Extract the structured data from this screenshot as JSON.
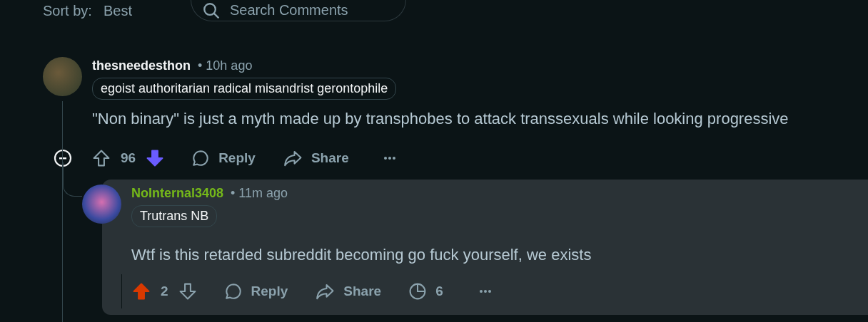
{
  "toolbar": {
    "sort_label": "Sort by:",
    "sort_value": "Best",
    "search": {
      "placeholder": "Search Comments"
    }
  },
  "comments": [
    {
      "author": "thesneedesthon",
      "color": "#f2f4f5",
      "time": "• 10h ago",
      "flair": "egoist authoritarian radical misandrist gerontophile",
      "body": "\"Non binary\" is just a myth made up by transphobes to attack transsexuals while looking progressive",
      "upvoted": false,
      "downvoted": true,
      "score": "96",
      "reply_label": "Reply",
      "share_label": "Share",
      "highlighted": false,
      "replies": [
        {
          "author": "NoInternal3408",
          "color": "#75b81a",
          "time": "• 11m ago",
          "flair": "Trutrans NB",
          "body": "Wtf is this retarded subreddit becoming go fuck yourself, we exists",
          "upvoted": true,
          "downvoted": false,
          "score": "2",
          "reply_label": "Reply",
          "share_label": "Share",
          "insights": "6",
          "highlighted": true
        }
      ]
    }
  ]
}
